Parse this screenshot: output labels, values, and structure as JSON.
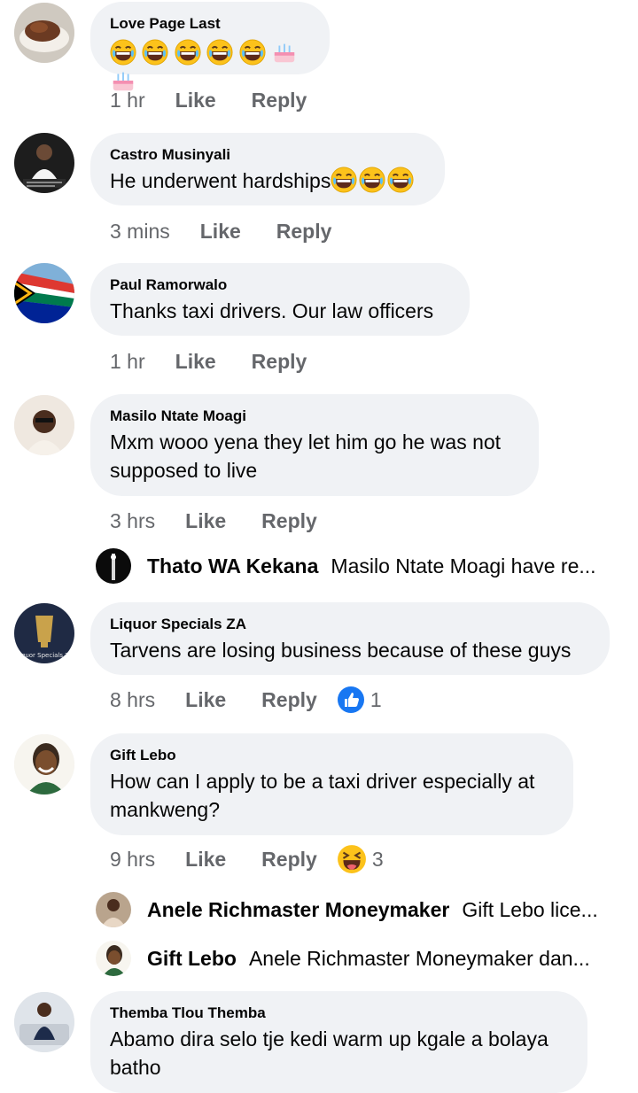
{
  "comments": [
    {
      "name": "Love Page Last",
      "text": "",
      "emojis": [
        "laugh",
        "laugh",
        "laugh",
        "laugh",
        "laugh",
        "cake",
        "cake"
      ],
      "time": "1 hr",
      "like": "Like",
      "reply": "Reply"
    },
    {
      "name": "Castro Musinyali",
      "text": "He underwent hardships",
      "emojis": [
        "laugh",
        "laugh",
        "laugh"
      ],
      "time": "3 mins",
      "like": "Like",
      "reply": "Reply"
    },
    {
      "name": "Paul Ramorwalo",
      "text": "Thanks taxi drivers. Our law officers",
      "time": "1 hr",
      "like": "Like",
      "reply": "Reply"
    },
    {
      "name": "Masilo Ntate Moagi",
      "text_line1": "Mxm wooo yena they let him go he was not",
      "text_line2": "supposed to live",
      "time": "3 hrs",
      "like": "Like",
      "reply": "Reply"
    },
    {
      "name": "Liquor Specials ZA",
      "text": "Tarvens are losing business because of these guys",
      "time": "8 hrs",
      "like": "Like",
      "reply": "Reply",
      "reaction_count": "1",
      "reaction_icon": "like-icon"
    },
    {
      "name": "Gift Lebo",
      "text_line1": "How can I apply to be a taxi driver especially at",
      "text_line2": "mankweng?",
      "time": "9 hrs",
      "like": "Like",
      "reply": "Reply",
      "reaction_count": "3",
      "reaction_icon": "haha-icon"
    },
    {
      "name": "Themba Tlou Themba",
      "text_line1": "Abamo dira selo tje kedi warm up kgale a bolaya",
      "text_line2": "batho"
    }
  ],
  "replies": [
    {
      "name": "Thato WA Kekana",
      "text": "Masilo Ntate Moagi have re..."
    },
    {
      "name": "Anele Richmaster Moneymaker",
      "text": "Gift Lebo lice..."
    },
    {
      "name": "Gift Lebo",
      "text": "Anele Richmaster Moneymaker dan..."
    }
  ],
  "avatar_labels": {
    "liquor": "iquor Specials Z"
  },
  "colors": {
    "bubble": "#f0f2f5",
    "meta": "#65676b",
    "like_blue": "#1877f2",
    "emoji_yellow": "#fcc21b"
  }
}
